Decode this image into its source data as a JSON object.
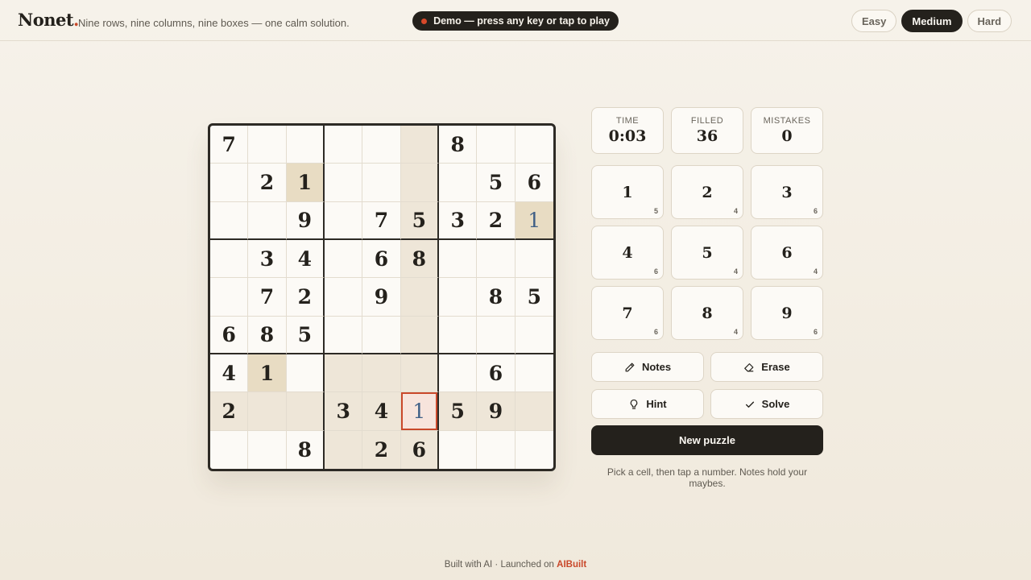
{
  "header": {
    "brand": "Nonet",
    "brand_dot": ".",
    "tagline": "Nine rows, nine columns, nine boxes — one calm solution.",
    "demo_banner": "Demo — press any key or tap to play",
    "difficulty": [
      {
        "label": "Easy",
        "active": false
      },
      {
        "label": "Medium",
        "active": true
      },
      {
        "label": "Hard",
        "active": false
      }
    ]
  },
  "board": {
    "selected": {
      "row": 7,
      "col": 5
    },
    "cells": [
      [
        "7",
        "",
        "",
        "",
        "",
        "",
        "8",
        "",
        ""
      ],
      [
        "",
        "2",
        "1",
        "",
        "",
        "",
        "",
        "5",
        "6"
      ],
      [
        "",
        "",
        "9",
        "",
        "7",
        "5",
        "3",
        "2",
        "1"
      ],
      [
        "",
        "3",
        "4",
        "",
        "6",
        "8",
        "",
        "",
        ""
      ],
      [
        "",
        "7",
        "2",
        "",
        "9",
        "",
        "",
        "8",
        "5"
      ],
      [
        "6",
        "8",
        "5",
        "",
        "",
        "",
        "",
        "",
        ""
      ],
      [
        "4",
        "1",
        "",
        "",
        "",
        "",
        "",
        "6",
        ""
      ],
      [
        "2",
        "",
        "",
        "3",
        "4",
        "1",
        "5",
        "9",
        ""
      ],
      [
        "",
        "",
        "8",
        "",
        "2",
        "6",
        "",
        "",
        ""
      ]
    ],
    "user_entries": [
      [
        2,
        8
      ],
      [
        7,
        5
      ]
    ]
  },
  "stats": [
    {
      "label": "TIME",
      "value": "0:03"
    },
    {
      "label": "FILLED",
      "value": "36"
    },
    {
      "label": "MISTAKES",
      "value": "0"
    }
  ],
  "numpad": [
    {
      "digit": "1",
      "remaining": "5"
    },
    {
      "digit": "2",
      "remaining": "4"
    },
    {
      "digit": "3",
      "remaining": "6"
    },
    {
      "digit": "4",
      "remaining": "6"
    },
    {
      "digit": "5",
      "remaining": "4"
    },
    {
      "digit": "6",
      "remaining": "4"
    },
    {
      "digit": "7",
      "remaining": "6"
    },
    {
      "digit": "8",
      "remaining": "4"
    },
    {
      "digit": "9",
      "remaining": "6"
    }
  ],
  "tools": {
    "notes": "Notes",
    "erase": "Erase",
    "hint": "Hint",
    "solve": "Solve",
    "new_puzzle": "New puzzle"
  },
  "helper_text": "Pick a cell, then tap a number. Notes hold your maybes.",
  "footer": {
    "text": "Built with AI · Launched on",
    "link": "AIBuilt"
  },
  "colors": {
    "accent": "#c9482a",
    "ink": "#24211c",
    "user_digit": "#3f5f86",
    "highlight": "#eee6d8"
  }
}
